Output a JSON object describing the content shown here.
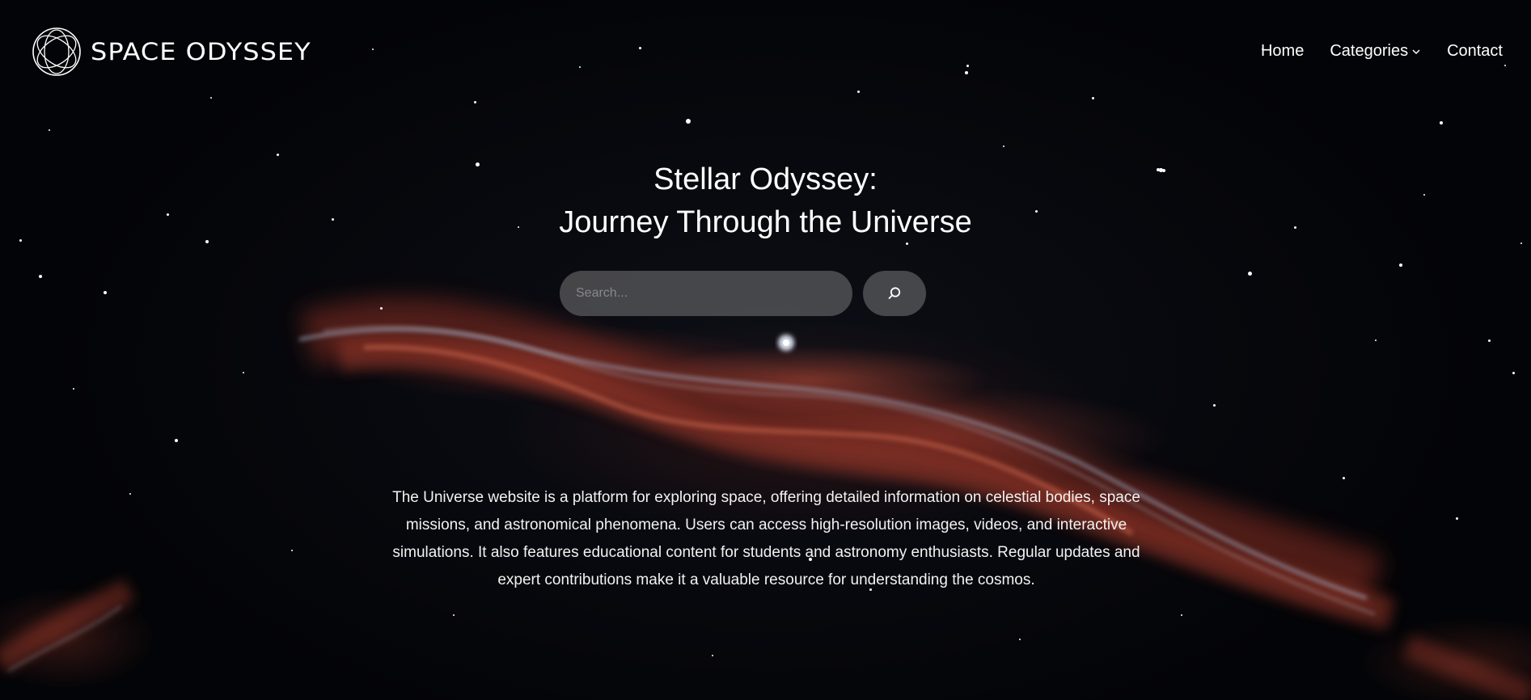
{
  "header": {
    "brand": "SPACE ODYSSEY",
    "logo_icon": "orbit-rings-icon",
    "nav": {
      "home": "Home",
      "categories": "Categories",
      "contact": "Contact"
    }
  },
  "hero": {
    "title_line1": "Stellar Odyssey:",
    "title_line2": "Journey Through the Universe",
    "search": {
      "placeholder": "Search...",
      "button_icon": "search-icon"
    },
    "description": "The Universe website is a platform for exploring space, offering detailed information on celestial bodies, space missions, and astronomical phenomena. Users can access high-resolution images, videos, and interactive simulations. It also features educational content for students and astronomy enthusiasts. Regular updates and expert contributions make it a valuable resource for understanding the cosmos."
  },
  "colors": {
    "background": "#05060a",
    "text": "#ffffff",
    "nebula_red": "#b4503c",
    "nebula_blue": "#9fb8d6",
    "control_fill": "#787878"
  }
}
